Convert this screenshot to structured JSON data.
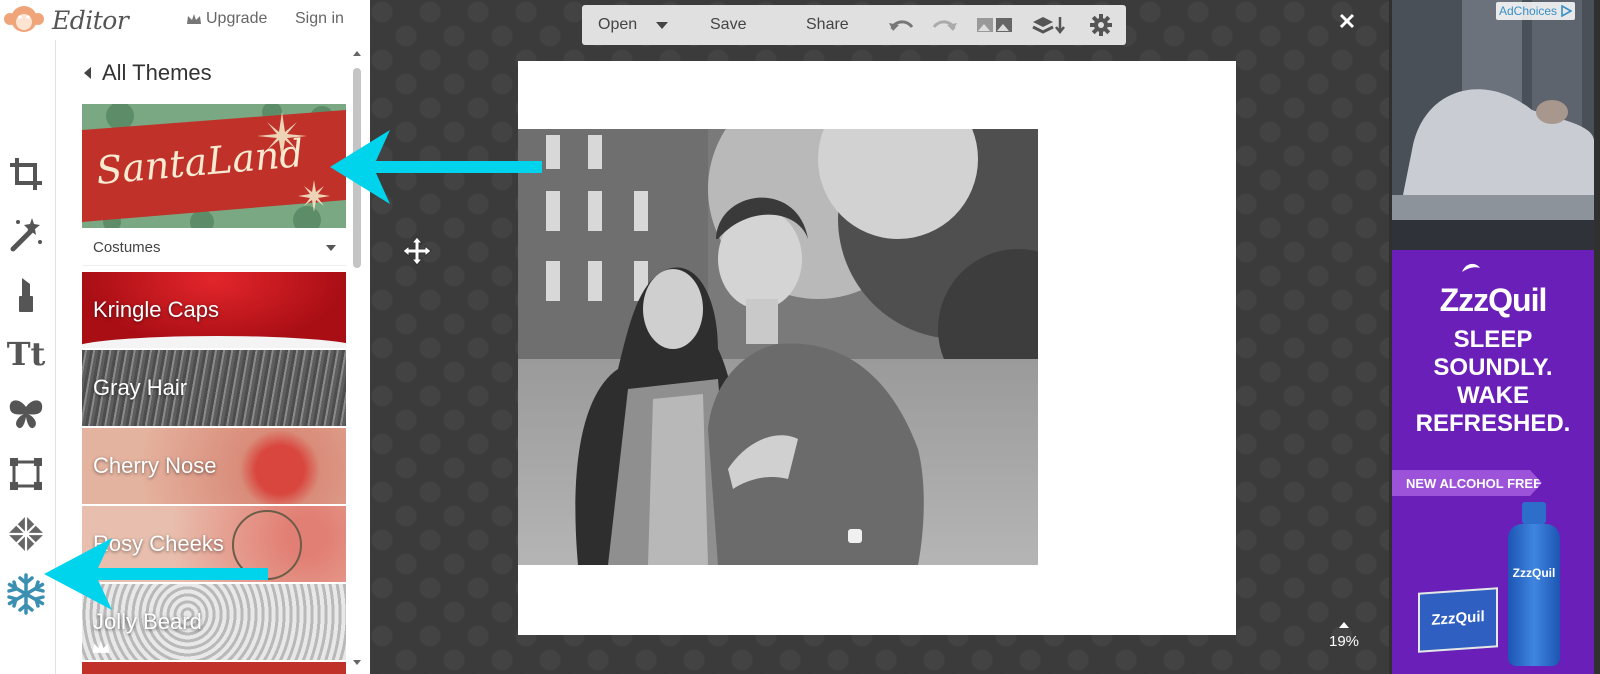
{
  "app": {
    "brand": "Editor",
    "upgrade_label": "Upgrade",
    "signin_label": "Sign in"
  },
  "tools": [
    "crop-icon",
    "magic-wand-icon",
    "lipstick-icon",
    "text-icon",
    "butterfly-icon",
    "frame-icon",
    "texture-icon",
    "snowflake-icon"
  ],
  "tools_text_glyph": "Tt",
  "themes_panel": {
    "back_label": "All Themes",
    "banner_text": "SantaLand",
    "category_label": "Costumes",
    "items": [
      {
        "label": "Kringle Caps",
        "color": "#c4161c"
      },
      {
        "label": "Gray Hair",
        "color": "#6f6f6f"
      },
      {
        "label": "Cherry Nose",
        "color": "#e8a58c"
      },
      {
        "label": "Rosy Cheeks",
        "color": "#e6b7a5"
      },
      {
        "label": "Jolly Beard",
        "color": "#cfcfcf"
      }
    ]
  },
  "toolbar": {
    "open_label": "Open",
    "save_label": "Save",
    "share_label": "Share"
  },
  "canvas": {
    "zoom_label": "19%"
  },
  "ad": {
    "adchoices_label": "AdChoices",
    "brand": "ZzzQuil",
    "line1": "SLEEP",
    "line2": "SOUNDLY.",
    "line3": "WAKE",
    "line4": "REFRESHED.",
    "badge": "NEW ALCOHOL FREE",
    "box_label": "ZzzQuil",
    "bottle_label": "ZzzQuil"
  },
  "colors": {
    "arrow": "#00d3ec",
    "ad_purple": "#6a1fb9",
    "workspace": "#3a3a3a"
  }
}
